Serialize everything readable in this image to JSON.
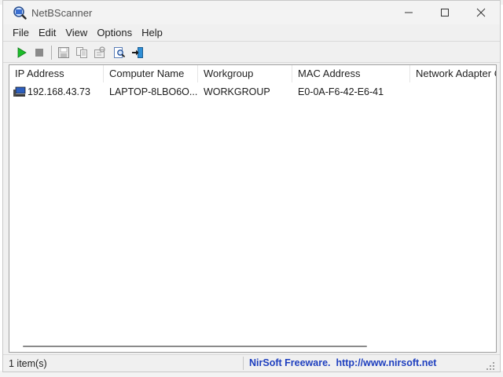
{
  "window": {
    "title": "NetBScanner",
    "controls": {
      "minimize": "minimize",
      "maximize": "maximize",
      "close": "close"
    }
  },
  "menu": [
    "File",
    "Edit",
    "View",
    "Options",
    "Help"
  ],
  "toolbar": {
    "buttons": [
      "start-scan",
      "stop-scan",
      "save",
      "copy",
      "properties",
      "find",
      "exit"
    ]
  },
  "table": {
    "columns": [
      "IP Address",
      "Computer Name",
      "Workgroup",
      "MAC Address",
      "Network Adapter C"
    ],
    "rows": [
      [
        "192.168.43.73",
        "LAPTOP-8LBO6O...",
        "WORKGROUP",
        "E0-0A-F6-42-E6-41",
        ""
      ]
    ]
  },
  "status": {
    "count": "1 item(s)",
    "link": "NirSoft Freeware.  http://www.nirsoft.net"
  },
  "colors": {
    "link": "#1e3fbf",
    "play": "#1cbd2a",
    "stop": "#8a8a8a"
  }
}
